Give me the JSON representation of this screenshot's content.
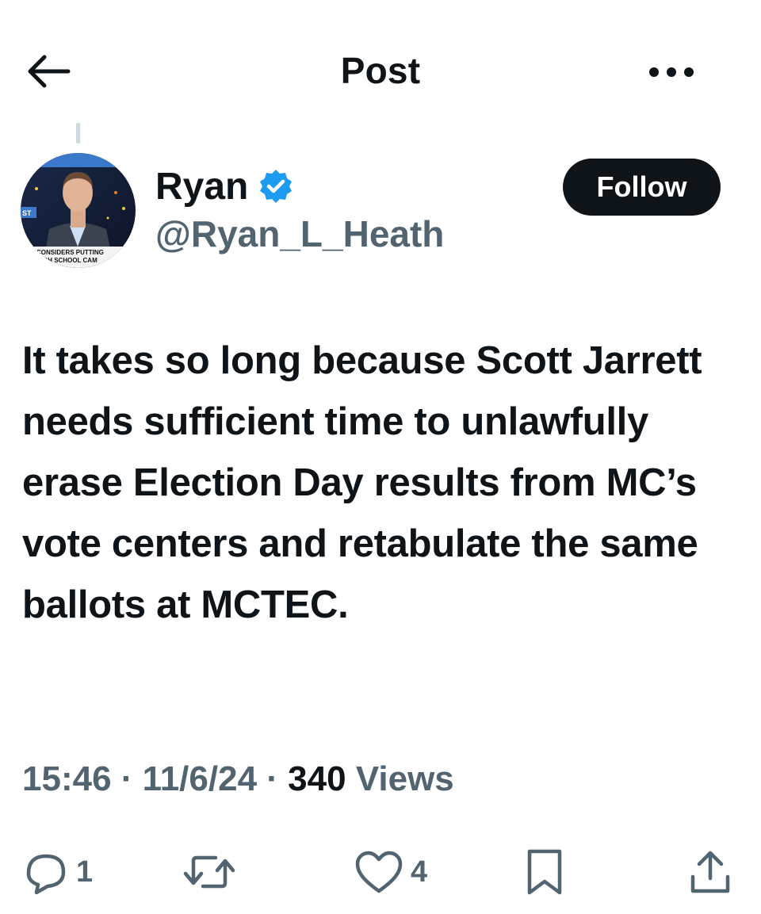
{
  "header": {
    "title": "Post",
    "back_icon": "arrow-left-icon",
    "more_icon": "more-horizontal-icon"
  },
  "author": {
    "display_name": "Ryan",
    "handle": "@Ryan_L_Heath",
    "verified": true,
    "follow_label": "Follow",
    "avatar_caption_line1": "D CONSIDERS PUTTING",
    "avatar_caption_line2": "N HIGH SCHOOL CAM",
    "avatar_corner_text": "ST"
  },
  "post": {
    "text": "It takes so long because Scott Jarrett needs sufficient time to unlawfully erase Election Day results from MC’s vote centers and retabulate the same ballots at MCTEC.",
    "time": "15:46",
    "separator": "·",
    "date": "11/6/24",
    "views_count": "340",
    "views_label": "Views"
  },
  "actions": {
    "replies": "1",
    "reposts": "",
    "likes": "4"
  },
  "colors": {
    "text_primary": "#0f1419",
    "text_secondary": "#536471",
    "verified_blue": "#1d9bf0",
    "follow_bg": "#0f1419"
  }
}
